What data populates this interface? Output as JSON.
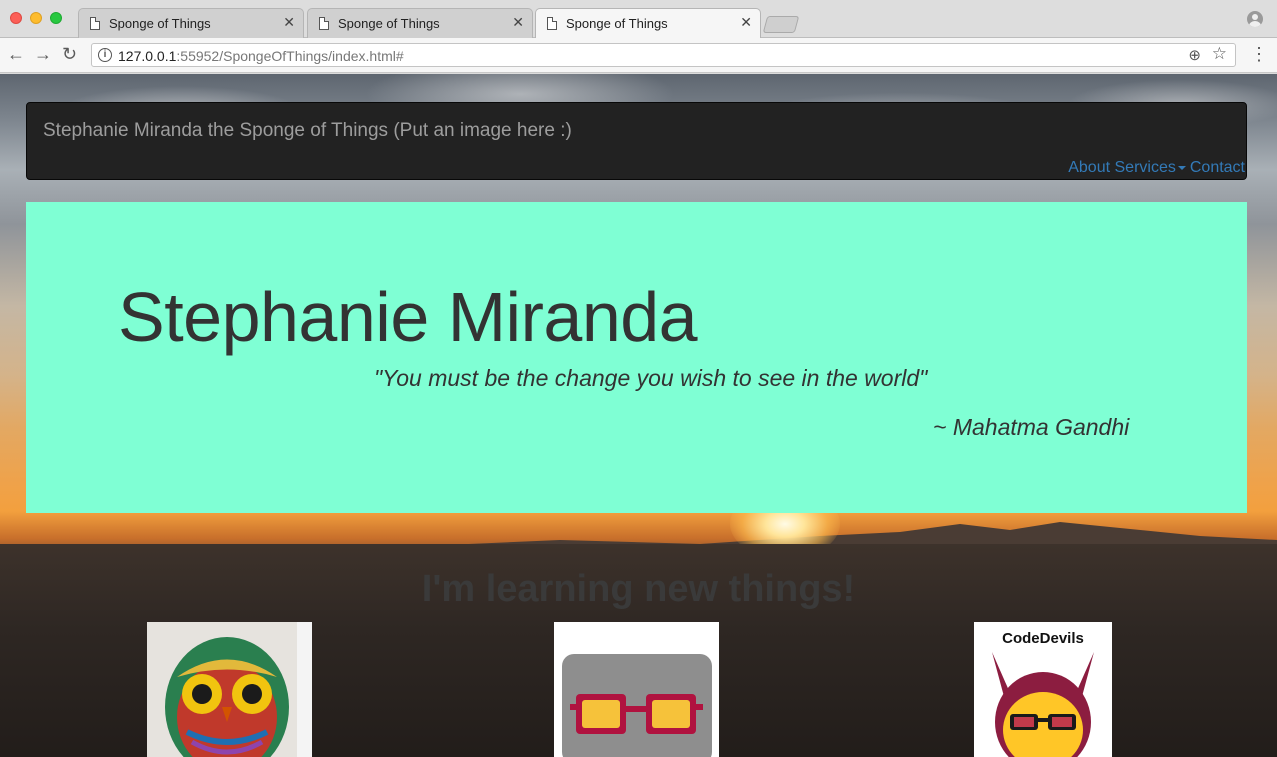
{
  "browser": {
    "tabs": [
      {
        "title": "Sponge of Things",
        "active": false
      },
      {
        "title": "Sponge of Things",
        "active": false
      },
      {
        "title": "Sponge of Things",
        "active": true
      }
    ],
    "url_host": "127.0.0.1",
    "url_rest": ":55952/SpongeOfThings/index.html#"
  },
  "navbar": {
    "brand": "Stephanie Miranda the Sponge of Things (Put an image here :)",
    "links": {
      "about": "About",
      "services": "Services",
      "contact": "Contact"
    }
  },
  "jumbotron": {
    "title": "Stephanie Miranda",
    "quote": "\"You must be the change you wish to see in the world\"",
    "author": "~ Mahatma Gandhi"
  },
  "section": {
    "heading": "I'm learning new things!"
  },
  "thumbnails": {
    "codedevils_label": "CodeDevils"
  },
  "colors": {
    "jumbotron_bg": "#7fffd4",
    "navbar_bg": "#222222",
    "link": "#337ab7"
  }
}
